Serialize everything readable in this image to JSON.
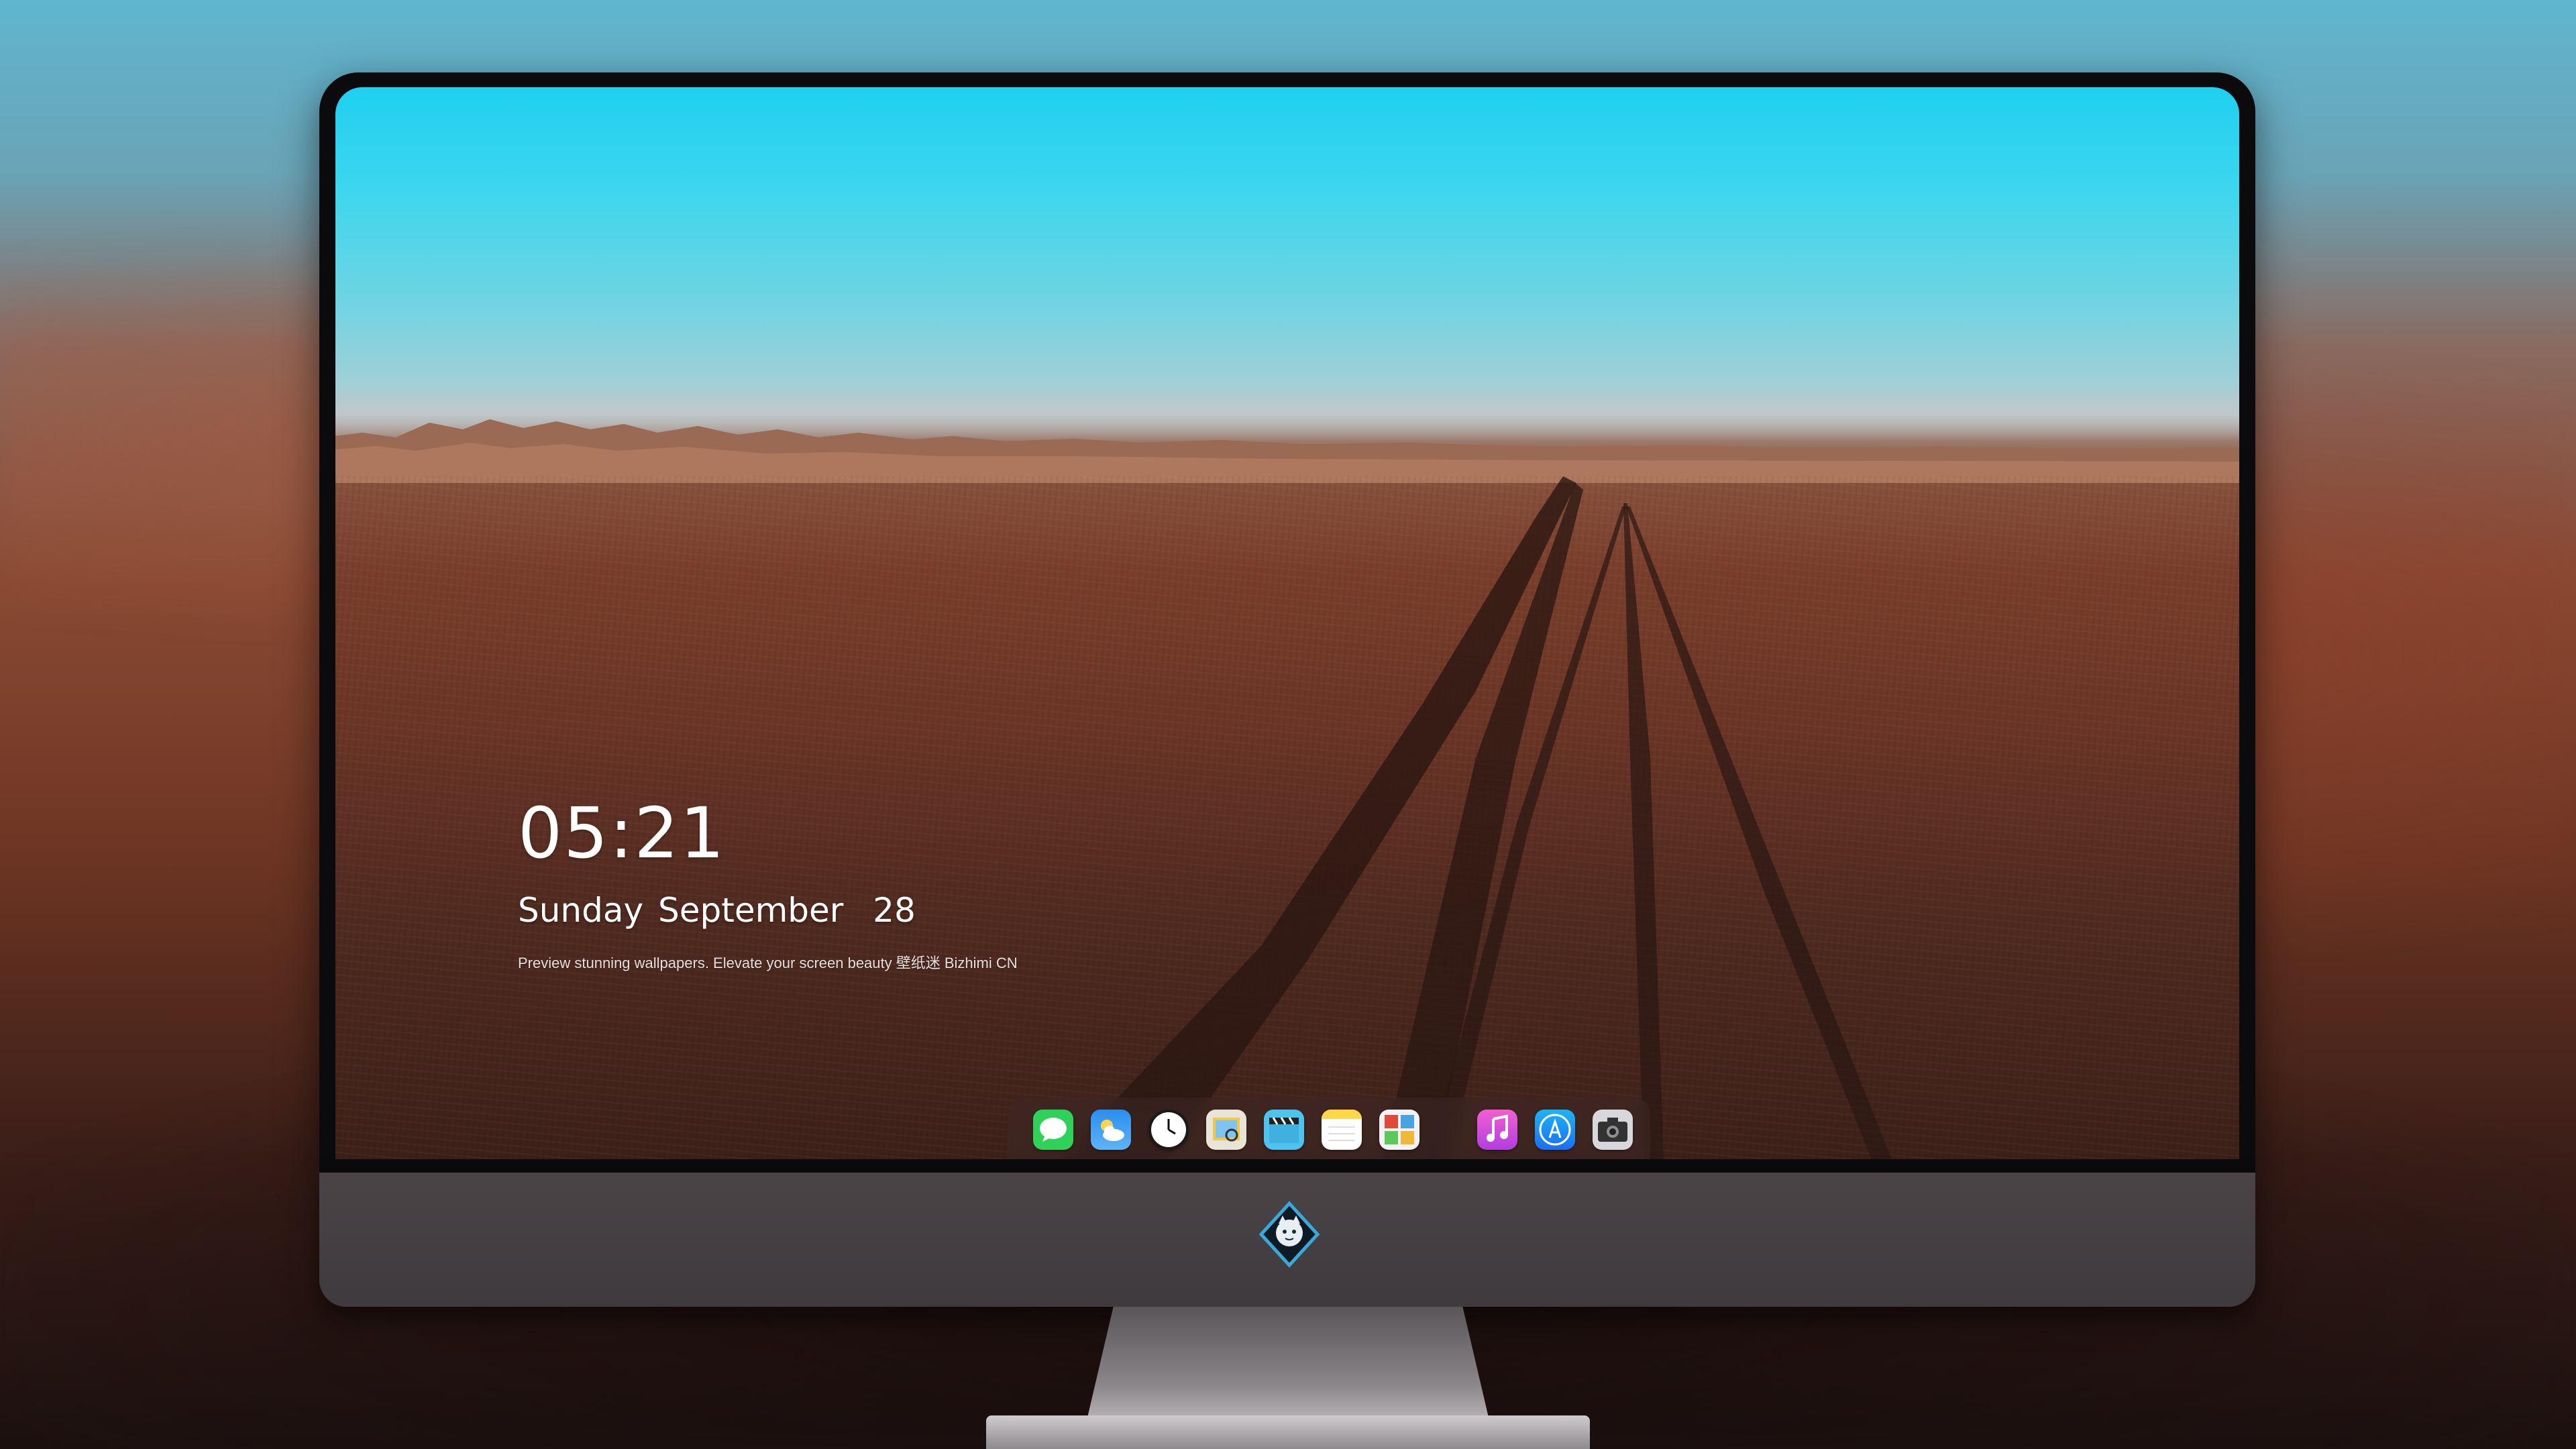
{
  "lock_screen": {
    "time": "05:21",
    "date": "Sunday September  28",
    "tagline": "Preview stunning wallpapers. Elevate your screen beauty 壁纸迷 Bizhimi CN"
  },
  "dock": {
    "apps": [
      {
        "icon": "messages-icon",
        "color": "#2fd158"
      },
      {
        "icon": "weather-icon",
        "color": "#2a8ef0"
      },
      {
        "icon": "clock-icon",
        "color": "#ffffff"
      },
      {
        "icon": "preview-icon",
        "color": "#f0c94a"
      },
      {
        "icon": "clips-icon",
        "color": "#4fc3f0"
      },
      {
        "icon": "notes-icon",
        "color": "#ffd54a"
      },
      {
        "icon": "photo-booth-icon",
        "color": "#e04a3a"
      },
      {
        "icon": "music-icon",
        "color": "#e24bd8"
      },
      {
        "icon": "app-store-icon",
        "color": "#1c8ef5"
      },
      {
        "icon": "camera-icon",
        "color": "#8e8e93"
      }
    ]
  },
  "monitor": {
    "logo": "mascot-logo-icon",
    "bezel_color": "#0b0b0d",
    "chin_color": "#433e41"
  }
}
